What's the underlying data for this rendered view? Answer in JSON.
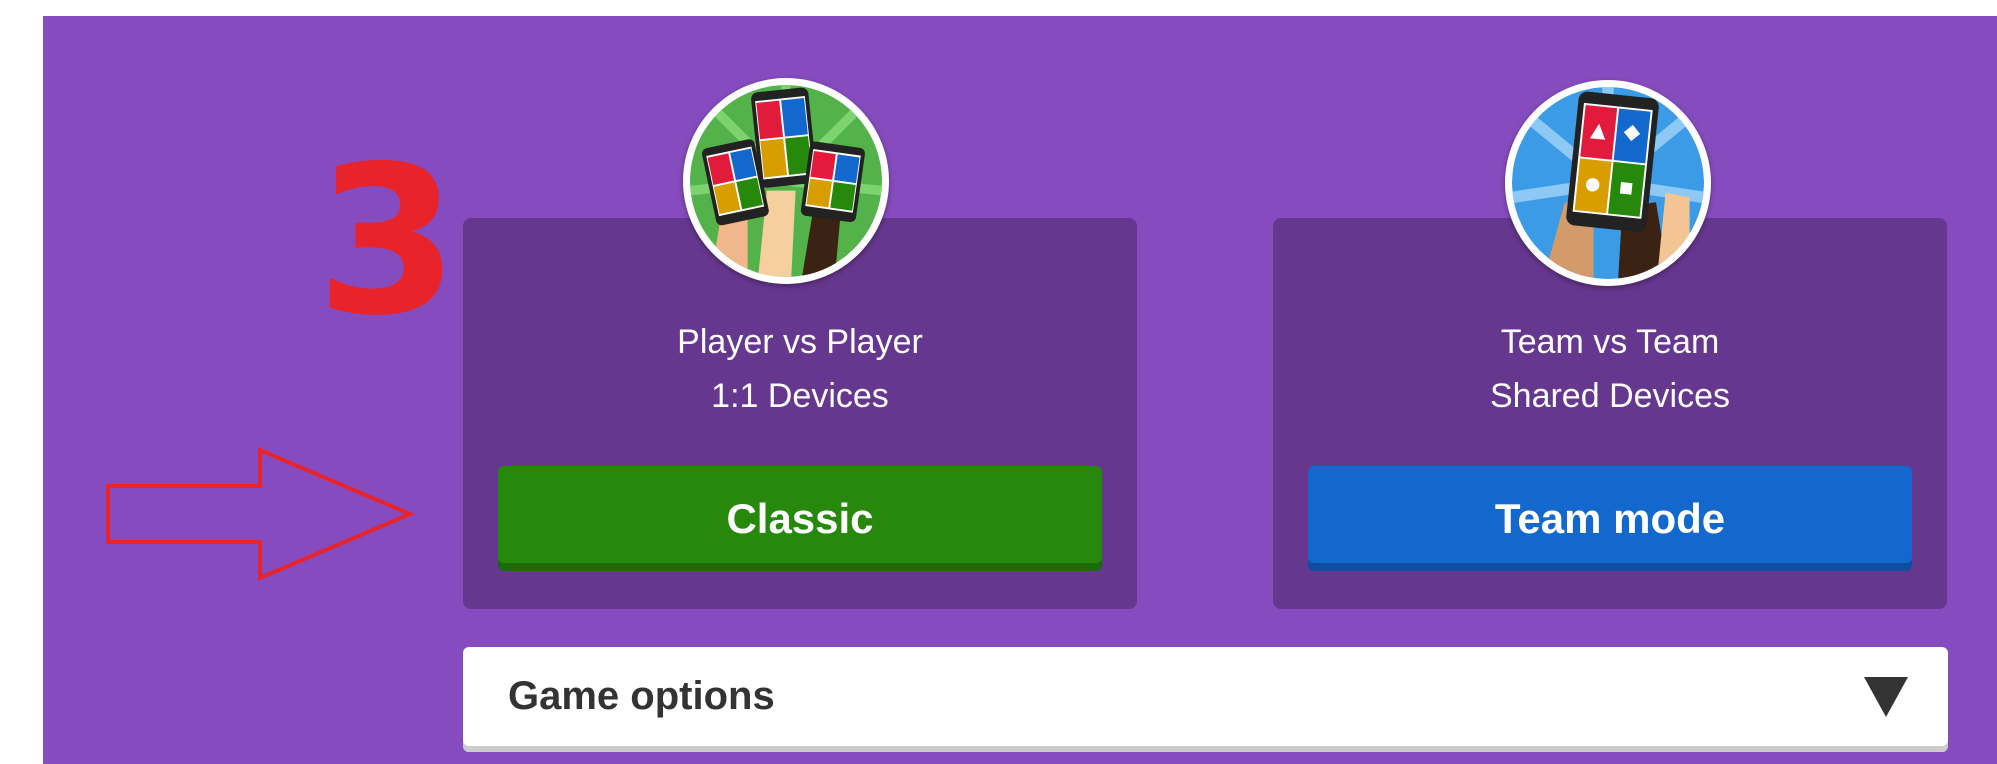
{
  "annotation": {
    "number": "3"
  },
  "modes": {
    "classic": {
      "line1": "Player vs Player",
      "line2": "1:1 Devices",
      "button_label": "Classic",
      "button_color": "#26890c"
    },
    "team": {
      "line1": "Team vs Team",
      "line2": "Shared Devices",
      "button_label": "Team mode",
      "button_color": "#1368ce"
    }
  },
  "game_options": {
    "label": "Game options",
    "icon": "caret-down-icon"
  },
  "colors": {
    "background": "#864cbf",
    "card": "#66378f",
    "annotation": "#e8232a"
  }
}
